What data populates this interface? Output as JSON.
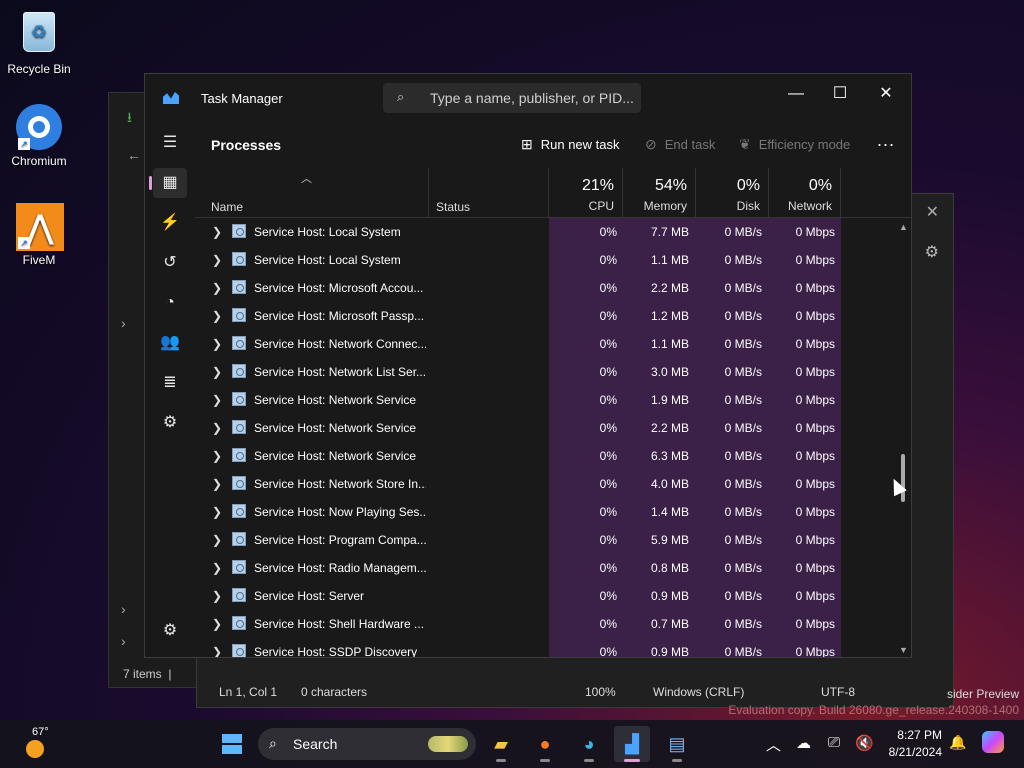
{
  "desktop": {
    "icons": [
      {
        "label": "Recycle Bin",
        "icon": "recycle-bin-icon"
      },
      {
        "label": "Chromium",
        "icon": "chromium-icon"
      },
      {
        "label": "FiveM",
        "icon": "fivem-icon"
      }
    ],
    "watermark_line1": "sider Preview",
    "watermark_line2": "Evaluation copy. Build 26080.ge_release.240308-1400"
  },
  "explorer": {
    "status": "7 items",
    "separator": "|"
  },
  "notepad": {
    "status": {
      "position": "Ln 1, Col 1",
      "chars": "0 characters",
      "zoom": "100%",
      "line_ending": "Windows (CRLF)",
      "encoding": "UTF-8"
    }
  },
  "task_manager": {
    "title": "Task Manager",
    "search_placeholder": "Type a name, publisher, or PID...",
    "page_title": "Processes",
    "toolbar": {
      "run_new_task": "Run new task",
      "end_task": "End task",
      "efficiency_mode": "Efficiency mode",
      "more": "..."
    },
    "columns": {
      "name": "Name",
      "status": "Status",
      "cpu_pct": "21%",
      "cpu": "CPU",
      "memory_pct": "54%",
      "memory": "Memory",
      "disk_pct": "0%",
      "disk": "Disk",
      "network_pct": "0%",
      "network": "Network"
    },
    "rows": [
      {
        "name": "Service Host: Local System",
        "cpu": "0%",
        "memory": "7.7 MB",
        "disk": "0 MB/s",
        "network": "0 Mbps"
      },
      {
        "name": "Service Host: Local System",
        "cpu": "0%",
        "memory": "1.1 MB",
        "disk": "0 MB/s",
        "network": "0 Mbps"
      },
      {
        "name": "Service Host: Microsoft Accou...",
        "cpu": "0%",
        "memory": "2.2 MB",
        "disk": "0 MB/s",
        "network": "0 Mbps"
      },
      {
        "name": "Service Host: Microsoft Passp...",
        "cpu": "0%",
        "memory": "1.2 MB",
        "disk": "0 MB/s",
        "network": "0 Mbps"
      },
      {
        "name": "Service Host: Network Connec...",
        "cpu": "0%",
        "memory": "1.1 MB",
        "disk": "0 MB/s",
        "network": "0 Mbps"
      },
      {
        "name": "Service Host: Network List Ser...",
        "cpu": "0%",
        "memory": "3.0 MB",
        "disk": "0 MB/s",
        "network": "0 Mbps"
      },
      {
        "name": "Service Host: Network Service",
        "cpu": "0%",
        "memory": "1.9 MB",
        "disk": "0 MB/s",
        "network": "0 Mbps"
      },
      {
        "name": "Service Host: Network Service",
        "cpu": "0%",
        "memory": "2.2 MB",
        "disk": "0 MB/s",
        "network": "0 Mbps"
      },
      {
        "name": "Service Host: Network Service",
        "cpu": "0%",
        "memory": "6.3 MB",
        "disk": "0 MB/s",
        "network": "0 Mbps"
      },
      {
        "name": "Service Host: Network Store In...",
        "cpu": "0%",
        "memory": "4.0 MB",
        "disk": "0 MB/s",
        "network": "0 Mbps"
      },
      {
        "name": "Service Host: Now Playing Ses...",
        "cpu": "0%",
        "memory": "1.4 MB",
        "disk": "0 MB/s",
        "network": "0 Mbps"
      },
      {
        "name": "Service Host: Program Compa...",
        "cpu": "0%",
        "memory": "5.9 MB",
        "disk": "0 MB/s",
        "network": "0 Mbps"
      },
      {
        "name": "Service Host: Radio Managem...",
        "cpu": "0%",
        "memory": "0.8 MB",
        "disk": "0 MB/s",
        "network": "0 Mbps"
      },
      {
        "name": "Service Host: Server",
        "cpu": "0%",
        "memory": "0.9 MB",
        "disk": "0 MB/s",
        "network": "0 Mbps"
      },
      {
        "name": "Service Host: Shell Hardware ...",
        "cpu": "0%",
        "memory": "0.7 MB",
        "disk": "0 MB/s",
        "network": "0 Mbps"
      },
      {
        "name": "Service Host: SSDP Discovery",
        "cpu": "0%",
        "memory": "0.9 MB",
        "disk": "0 MB/s",
        "network": "0 Mbps"
      }
    ]
  },
  "taskbar": {
    "temperature": "67°",
    "search_label": "Search",
    "time": "8:27 PM",
    "date": "8/21/2024"
  },
  "colors": {
    "accent": "#e0a0d8",
    "resource_highlight": "#3b2047"
  }
}
